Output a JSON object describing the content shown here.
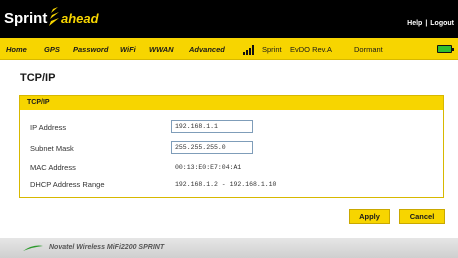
{
  "header": {
    "brand": "Sprint",
    "tagline": "ahead",
    "links": [
      "Help",
      "Logout"
    ],
    "separator": "|"
  },
  "nav": {
    "items": [
      "Home",
      "GPS",
      "Password",
      "WiFi",
      "WWAN",
      "Advanced"
    ],
    "carrier": "Sprint",
    "network": "EvDO Rev.A",
    "connection": "Dormant",
    "signal_level": 4,
    "battery": "charged"
  },
  "page": {
    "title": "TCP/IP"
  },
  "panel": {
    "heading": "TCP/IP",
    "ip_address": {
      "label": "IP Address",
      "value": "192.168.1.1"
    },
    "subnet_mask": {
      "label": "Subnet Mask",
      "value": "255.255.255.0"
    },
    "mac_address": {
      "label": "MAC Address",
      "value": "00:13:E0:E7:04:A1"
    },
    "dhcp_range": {
      "label": "DHCP Address Range",
      "value": "192.168.1.2 - 192.168.1.10"
    }
  },
  "buttons": {
    "apply": "Apply",
    "cancel": "Cancel"
  },
  "footer": {
    "text": "Novatel Wireless MiFi2200 SPRINT"
  },
  "colors": {
    "accent": "#f7d500",
    "header_bg": "#000000",
    "battery": "#2fbf2f"
  }
}
